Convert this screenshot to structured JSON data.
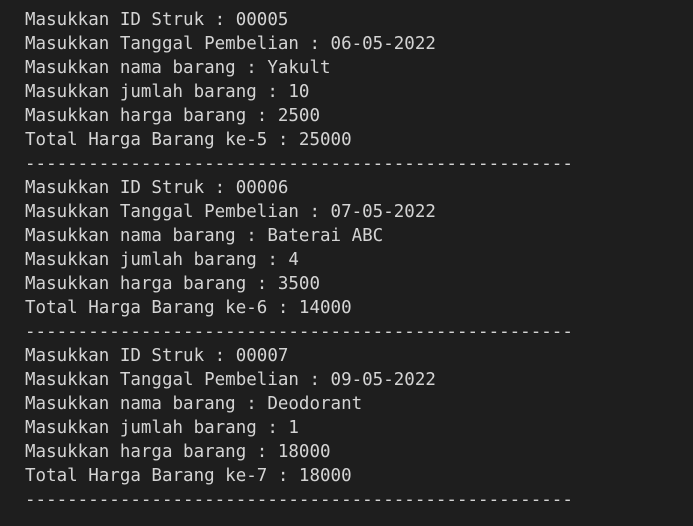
{
  "terminal": {
    "records": [
      {
        "id_line": "Masukkan ID Struk : 00005",
        "date_line": "Masukkan Tanggal Pembelian : 06-05-2022",
        "name_line": "Masukkan nama barang : Yakult",
        "qty_line": "Masukkan jumlah barang : 10",
        "price_line": "Masukkan harga barang : 2500",
        "total_line": "Total Harga Barang ke-5 : 25000",
        "separator": "----------------------------------------------------"
      },
      {
        "id_line": "Masukkan ID Struk : 00006",
        "date_line": "Masukkan Tanggal Pembelian : 07-05-2022",
        "name_line": "Masukkan nama barang : Baterai ABC",
        "qty_line": "Masukkan jumlah barang : 4",
        "price_line": "Masukkan harga barang : 3500",
        "total_line": "Total Harga Barang ke-6 : 14000",
        "separator": "----------------------------------------------------"
      },
      {
        "id_line": "Masukkan ID Struk : 00007",
        "date_line": "Masukkan Tanggal Pembelian : 09-05-2022",
        "name_line": "Masukkan nama barang : Deodorant",
        "qty_line": "Masukkan jumlah barang : 1",
        "price_line": "Masukkan harga barang : 18000",
        "total_line": "Total Harga Barang ke-7 : 18000",
        "separator": "----------------------------------------------------"
      }
    ],
    "colors": {
      "background": "#1e1e1e",
      "text": "#d4d4d4"
    }
  }
}
